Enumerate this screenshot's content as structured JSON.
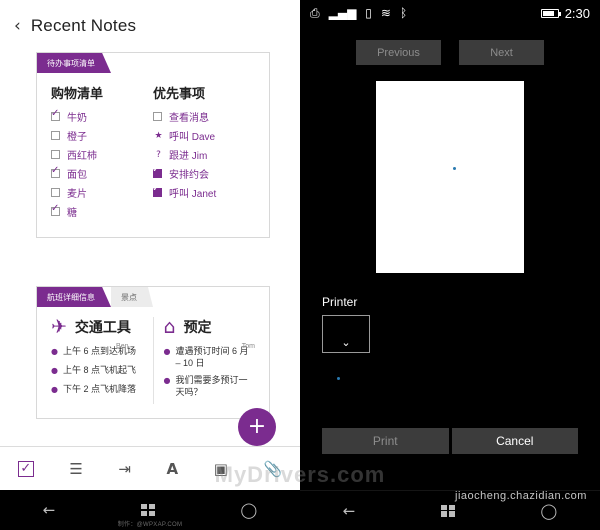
{
  "left": {
    "header": {
      "back_icon": "‹",
      "title": "Recent Notes"
    },
    "note1": {
      "tabs": [
        {
          "label": "待办事项清单",
          "style": "purple"
        }
      ],
      "columns": [
        {
          "title": "购物清单",
          "items": [
            {
              "label": "牛奶",
              "checked": true
            },
            {
              "label": "橙子",
              "checked": false
            },
            {
              "label": "西红柿",
              "checked": false
            },
            {
              "label": "面包",
              "checked": true
            },
            {
              "label": "麦片",
              "checked": false
            },
            {
              "label": "糖",
              "checked": true
            }
          ]
        },
        {
          "title": "优先事项",
          "items": [
            {
              "label": "查看消息",
              "mark": "checkbox"
            },
            {
              "label": "呼叫 Dave",
              "mark": "star"
            },
            {
              "label": "跟进 Jim",
              "mark": "question"
            },
            {
              "label": "安排约会",
              "mark": "filled"
            },
            {
              "label": "呼叫 Janet",
              "mark": "filled"
            }
          ]
        }
      ]
    },
    "note2": {
      "tabs": [
        {
          "label": "航班详细信息",
          "style": "purple"
        },
        {
          "label": "景点",
          "style": "grey"
        }
      ],
      "columns": [
        {
          "icon": "airplane",
          "title": "交通工具",
          "author": "Ben",
          "bullets": [
            "上午 6 点到达机场",
            "上午 8 点飞机起飞",
            "下午 2 点飞机降落"
          ]
        },
        {
          "icon": "home",
          "title": "预定",
          "author": "Tom",
          "bullets": [
            "遭遇预订时间 6 月 – 10 日",
            "我们需要多预订一天吗？"
          ]
        }
      ]
    },
    "fab": {
      "label": "+"
    },
    "toolbar": [
      {
        "name": "checklist-icon",
        "glyph": "✓"
      },
      {
        "name": "bullet-list-icon",
        "glyph": "☰"
      },
      {
        "name": "indent-icon",
        "glyph": "⇥"
      },
      {
        "name": "text-format-icon",
        "glyph": "A"
      },
      {
        "name": "image-icon",
        "glyph": "▣"
      },
      {
        "name": "attachment-icon",
        "glyph": "📎"
      }
    ],
    "navbar": [
      {
        "name": "back-nav-icon",
        "glyph": "←"
      },
      {
        "name": "windows-start-icon",
        "glyph": ""
      },
      {
        "name": "search-nav-icon",
        "glyph": "◯"
      }
    ],
    "credit": "制作：@WPXAP.COM"
  },
  "right": {
    "status": {
      "icons": [
        "screenshot-icon",
        "signal-icon",
        "battery-saver-icon",
        "wifi-icon",
        "bluetooth-icon"
      ],
      "clock": "2:30"
    },
    "nav": {
      "previous": "Previous",
      "next": "Next"
    },
    "printer": {
      "label": "Printer",
      "selected": "",
      "chevron": "⌄"
    },
    "actions": {
      "print": "Print",
      "cancel": "Cancel"
    },
    "navbar": [
      {
        "name": "back-nav-icon",
        "glyph": "←"
      },
      {
        "name": "windows-start-icon",
        "glyph": ""
      },
      {
        "name": "search-nav-icon",
        "glyph": "◯"
      }
    ]
  },
  "watermarks": {
    "main": "MyDrivers.com",
    "secondary": "jiaocheng.chazidian.com"
  },
  "colors": {
    "accent_purple": "#7b2c8f",
    "dark_bg": "#000000",
    "button_grey": "#3c3c3c"
  }
}
